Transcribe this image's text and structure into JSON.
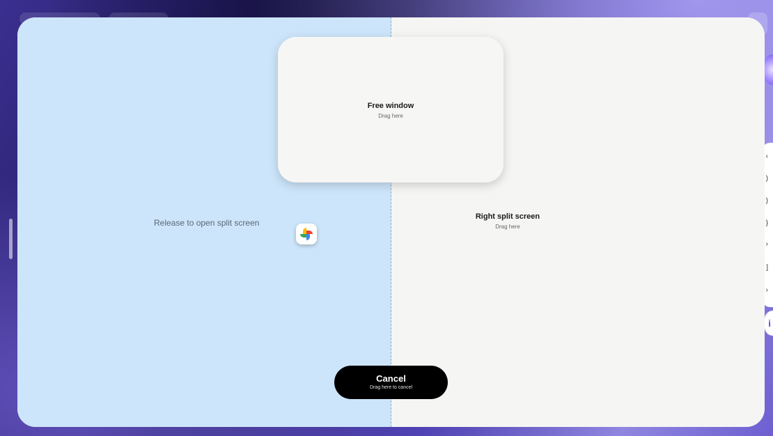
{
  "free_window": {
    "title": "Free window",
    "subtitle": "Drag here"
  },
  "left_zone": {
    "hint": "Release to open split screen",
    "color": "#cde5fa"
  },
  "right_zone": {
    "title": "Right split screen",
    "subtitle": "Drag here",
    "color": "#f5f5f4"
  },
  "cancel": {
    "title": "Cancel",
    "subtitle": "Drag here to cancel"
  },
  "dragged_app": {
    "icon": "google-photos-pinwheel-icon"
  },
  "edge_panel": {
    "glyphs": [
      "‹",
      ")",
      ")",
      "}",
      "›",
      "]",
      "›"
    ],
    "bubble": "i"
  }
}
